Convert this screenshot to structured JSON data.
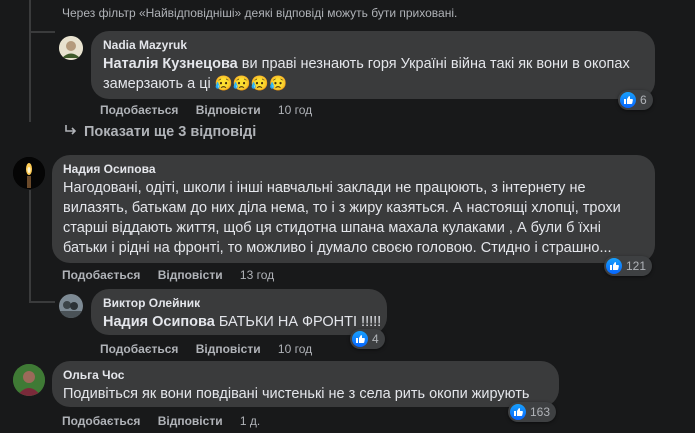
{
  "filter_note": "Через фільтр «Найвідповідніші» деякі відповіді можуть бути приховані.",
  "labels": {
    "like": "Подобається",
    "reply": "Відповісти"
  },
  "comments": [
    {
      "author": "Nadia Mazyruk",
      "mention": "Наталія Кузнецова",
      "text": "ви праві незнають горя Україні війна такі як вони в окопах замерзають а ці 😥😥😥😥",
      "time": "10 год",
      "reactions": "6"
    },
    {
      "show_more": "Показати ще 3 відповіді"
    },
    {
      "author": "Надия Осипова",
      "text": "Нагодовані, одіті, школи і інші навчальні заклади не працюють, з інтернету не вилазять, батькам до них діла нема, то і з жиру казяться. А настоящі хлопці, трохи старші віддають життя, щоб ця стидотна шпана махала кулаками , А були б їхні батьки і рідні на фронті, то можливо і думало своєю головою. Стидно і страшно...",
      "time": "13 год",
      "reactions": "121"
    },
    {
      "author": "Виктор Олейник",
      "mention": "Надия Осипова",
      "text": "БАТЬКИ НА ФРОНТІ !!!!!",
      "time": "10 год",
      "reactions": "4"
    },
    {
      "author": "Ольга Чос",
      "text": "Подивіться як вони повдівані чистенькі не з села рить окопи жирують",
      "time": "1 д.",
      "reactions": "163"
    }
  ],
  "colors": {
    "background": "#18191a",
    "bubble": "#3a3b3c",
    "text": "#e4e6eb",
    "muted": "#b0b3b8",
    "like": "#0866ff"
  }
}
